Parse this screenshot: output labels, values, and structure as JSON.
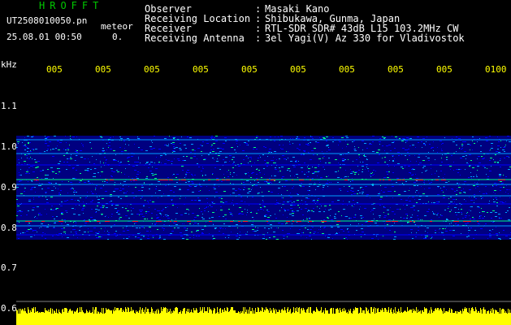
{
  "header": {
    "brand": "HROFFT",
    "file_name": "UT2508010050.pn",
    "meteor_label": "meteor",
    "date_time": "25.08.01 00:50",
    "status_indicator": "0."
  },
  "info": [
    {
      "label": "Observer",
      "value": "Masaki Kano"
    },
    {
      "label": "Receiving Location",
      "value": "Shibukawa, Gunma, Japan"
    },
    {
      "label": "Receiver",
      "value": "RTL-SDR SDR# 43dB L15 103.2MHz CW"
    },
    {
      "label": "Receiving Antenna",
      "value": "3el Yagi(V) Az 330 for Vladivostok"
    }
  ],
  "axis": {
    "unit": "kHz",
    "time_ticks": [
      "005",
      "005",
      "005",
      "005",
      "005",
      "005",
      "005",
      "005",
      "005",
      "0100"
    ],
    "freq_ticks": [
      "1.1",
      "1.0",
      "0.9",
      "0.8",
      "0.7",
      "0.6"
    ]
  },
  "colors": {
    "label_green": "#00c800",
    "text_white": "#ffffff",
    "tick_yellow": "#ffff00",
    "background": "#000000",
    "noise_floor": "#000080",
    "signal_low": "#0000ff",
    "signal_mid": "#00a0ff",
    "signal_high": "#00ff80",
    "signal_peak": "#ff2020",
    "power_bar": "#ffff00"
  }
}
